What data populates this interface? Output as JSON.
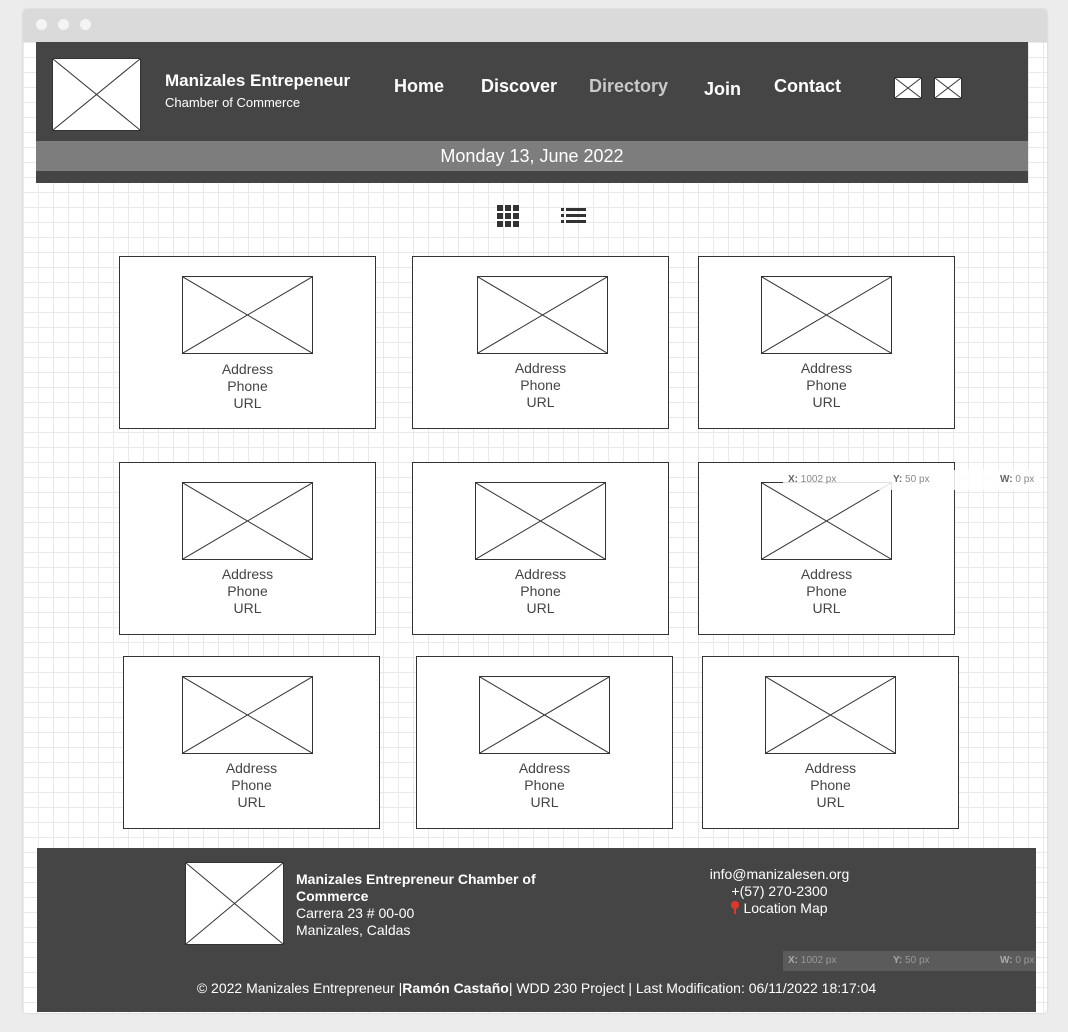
{
  "header": {
    "brand_name": "Manizales Entrepeneur",
    "brand_sub": "Chamber of Commerce",
    "nav": [
      {
        "label": "Home",
        "active": false
      },
      {
        "label": "Discover",
        "active": false
      },
      {
        "label": "Directory",
        "active": true
      },
      {
        "label": "Join",
        "active": false
      },
      {
        "label": "Contact",
        "active": false
      }
    ],
    "date": "Monday 13, June 2022"
  },
  "view_toggle": {
    "grid_icon": "grid-icon",
    "list_icon": "list-icon"
  },
  "directory": {
    "cards": [
      {
        "address": "Address",
        "phone": "Phone",
        "url": "URL"
      },
      {
        "address": "Address",
        "phone": "Phone",
        "url": "URL"
      },
      {
        "address": "Address",
        "phone": "Phone",
        "url": "URL"
      },
      {
        "address": "Address",
        "phone": "Phone",
        "url": "URL"
      },
      {
        "address": "Address",
        "phone": "Phone",
        "url": "URL"
      },
      {
        "address": "Address",
        "phone": "Phone",
        "url": "URL"
      },
      {
        "address": "Address",
        "phone": "Phone",
        "url": "URL"
      },
      {
        "address": "Address",
        "phone": "Phone",
        "url": "URL"
      },
      {
        "address": "Address",
        "phone": "Phone",
        "url": "URL"
      }
    ]
  },
  "ruler": {
    "x_key": "X:",
    "x_val": "1002 px",
    "y_key": "Y:",
    "y_val": "50 px",
    "w_key": "W:",
    "w_val": "0 px"
  },
  "footer": {
    "org_name": "Manizales Entrepreneur Chamber of Commerce",
    "address_line1": "Carrera 23 # 00-00",
    "address_line2": "Manizales, Caldas",
    "email": "info@manizalesen.org",
    "phone": "+(57) 270-2300",
    "location_link": "Location Map",
    "copy_prefix": "© 2022 Manizales Entrepreneur |",
    "copy_author": "Ramón Castaño",
    "copy_suffix": "| WDD 230 Project | Last Modification: 06/11/2022 18:17:04"
  },
  "colors": {
    "header_bg": "#454545",
    "datebar_bg": "#7d7d7d",
    "active_nav": "#c9c9c9",
    "pin": "#e0362b"
  }
}
